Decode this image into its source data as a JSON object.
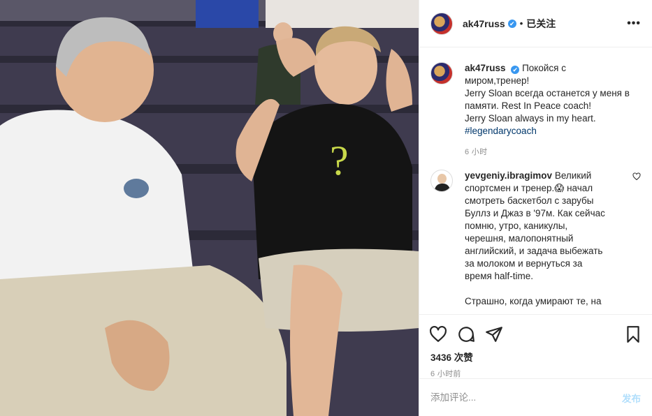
{
  "post": {
    "username": "ak47russ",
    "verified_mark": "✔",
    "separator": "•",
    "follow_status": "已关注",
    "more": "•••"
  },
  "caption": {
    "username": "ak47russ",
    "lines": [
      "Покойся с",
      "миром,тренер!",
      "Jerry Sloan всегда останется у меня в",
      "памяти. Rest In Peace coach!",
      "Jerry Sloan always in my heart."
    ],
    "hashtag": "#legendarycoach",
    "time": "6 小时"
  },
  "comment": {
    "username": "yevgeniy.ibragimov",
    "lines": [
      "Великий",
      "спортсмен и тренер.😱 начал",
      "смотреть баскетбол с зарубы",
      "Буллз и Джаз в '97м. Как сейчас",
      "помню, утро, каникулы,",
      "черешня, малопонятный",
      "английский, и задача выбежать",
      "за молоком и вернуться за",
      "время half-time.",
      "",
      "Страшно, когда умирают те, на"
    ]
  },
  "stats": {
    "likes": "3436 次赞",
    "posted": "6 小时前"
  },
  "add_comment": {
    "placeholder": "添加评论...",
    "post_label": "发布"
  },
  "colors": {
    "link": "#00376b",
    "verified": "#3897f0",
    "post_button": "#b2dffc",
    "muted": "#8e8e8e"
  }
}
